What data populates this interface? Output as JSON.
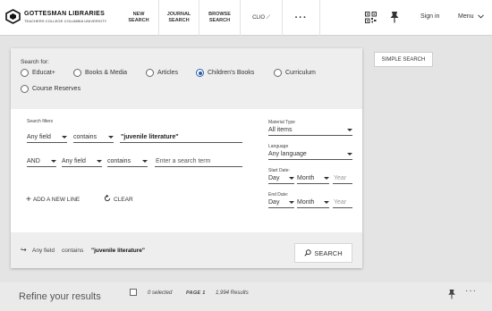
{
  "header": {
    "logo_line1": "GOTTESMAN LIBRARIES",
    "logo_line2": "TEACHERS COLLEGE COLUMBIA UNIVERSITY",
    "nav": [
      {
        "label": "NEW\nSEARCH"
      },
      {
        "label": "JOURNAL\nSEARCH"
      },
      {
        "label": "BROWSE\nSEARCH"
      },
      {
        "label": "CLIO ⟋"
      }
    ],
    "more_label": "···",
    "sign_in": "Sign in",
    "menu": "Menu",
    "icons": [
      "qr-code-icon",
      "pin-icon",
      "chevron-down-icon"
    ]
  },
  "search": {
    "scope_label": "Search for:",
    "scopes": [
      {
        "label": "Educat+",
        "selected": false
      },
      {
        "label": "Books & Media",
        "selected": false
      },
      {
        "label": "Articles",
        "selected": false
      },
      {
        "label": "Children's Books",
        "selected": true
      },
      {
        "label": "Curriculum",
        "selected": false
      },
      {
        "label": "Course Reserves",
        "selected": false
      }
    ],
    "filters_label": "Search filters",
    "row1": {
      "field": "Any field",
      "operator": "contains",
      "term": "\"juvenile literature\""
    },
    "row2": {
      "boolean": "AND",
      "field": "Any field",
      "operator": "contains",
      "placeholder": "Enter a search term"
    },
    "add_line": "ADD A NEW LINE",
    "clear": "CLEAR",
    "material_type_label": "Material Type",
    "material_type_value": "All items",
    "language_label": "Language",
    "language_value": "Any language",
    "start_date_label": "Start Date:",
    "end_date_label": "End Date:",
    "day": "Day",
    "month": "Month",
    "year_placeholder": "Year",
    "summary": {
      "field": "Any field",
      "operator": "contains",
      "term": "\"juvenile literature\""
    },
    "search_button": "SEARCH",
    "simple_search": "SIMPLE SEARCH"
  },
  "results": {
    "refine": "Refine your results",
    "selected": "0 selected",
    "page": "PAGE 1",
    "count": "1,994 Results"
  },
  "colors": {
    "accent": "#2a5da8",
    "panel_gray": "#eeeeee",
    "page_bg": "#e4e4e4"
  }
}
